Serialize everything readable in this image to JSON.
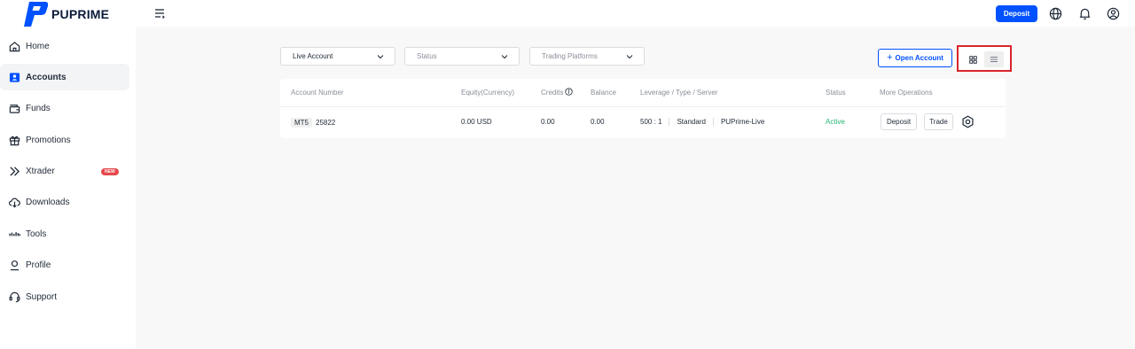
{
  "brand": {
    "name": "PUPRIME",
    "color": "#0051ff"
  },
  "sidebar": {
    "items": [
      {
        "label": "Home",
        "icon": "home-icon",
        "active": false
      },
      {
        "label": "Accounts",
        "icon": "accounts-icon",
        "active": true
      },
      {
        "label": "Funds",
        "icon": "wallet-icon",
        "active": false
      },
      {
        "label": "Promotions",
        "icon": "gift-icon",
        "active": false
      },
      {
        "label": "Xtrader",
        "icon": "double-chevron-icon",
        "active": false,
        "badge": "NEW"
      },
      {
        "label": "Downloads",
        "icon": "download-icon",
        "active": false
      },
      {
        "label": "Tools",
        "icon": "tools-icon",
        "active": false
      },
      {
        "label": "Profile",
        "icon": "user-icon",
        "active": false
      },
      {
        "label": "Support",
        "icon": "headset-icon",
        "active": false
      }
    ]
  },
  "header": {
    "deposit_label": "Deposit",
    "icons": [
      "globe-icon",
      "bell-icon",
      "user-circle-icon"
    ]
  },
  "filters": {
    "account": "Live Account",
    "status_placeholder": "Status",
    "platform_placeholder": "Trading Platforms"
  },
  "actions": {
    "open_account_label": "Open Account"
  },
  "table": {
    "headers": {
      "account_number": "Account Number",
      "equity": "Equity(Currency)",
      "credits": "Credits",
      "balance": "Balance",
      "leverage": "Leverage / Type / Server",
      "status": "Status",
      "operations": "More Operations"
    },
    "rows": [
      {
        "platform": "MT5",
        "account_number": "25822",
        "equity": "0.00 USD",
        "credits": "0.00",
        "balance": "0.00",
        "leverage": "500 : 1",
        "type": "Standard",
        "server": "PUPrime-Live",
        "status": "Active",
        "deposit_label": "Deposit",
        "trade_label": "Trade"
      }
    ]
  },
  "colors": {
    "accent": "#0051ff",
    "active_status": "#22b573",
    "badge": "#e5484d",
    "highlight_box": "#d9252b"
  }
}
